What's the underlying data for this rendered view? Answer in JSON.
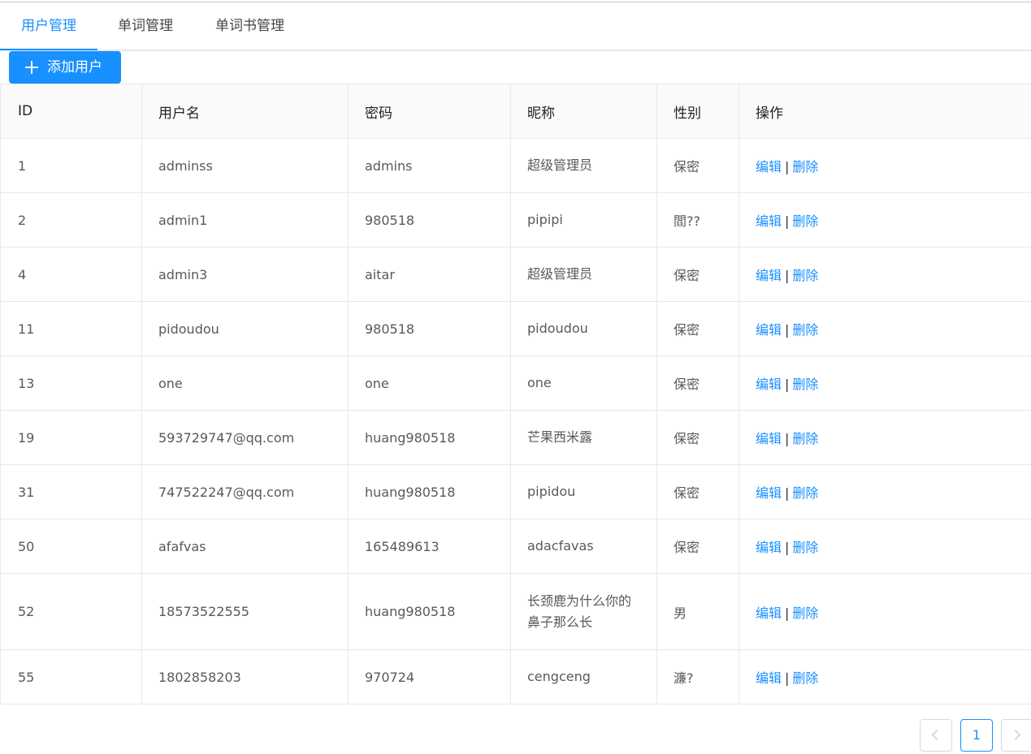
{
  "tabs": [
    {
      "label": "用户管理",
      "active": true
    },
    {
      "label": "单词管理",
      "active": false
    },
    {
      "label": "单词书管理",
      "active": false
    }
  ],
  "toolbar": {
    "add_label": "添加用户",
    "add_icon": "plus-icon"
  },
  "table": {
    "columns": [
      "ID",
      "用户名",
      "密码",
      "昵称",
      "性别",
      "操作"
    ],
    "actions": {
      "edit": "编辑",
      "separator": "|",
      "delete": "删除"
    },
    "rows": [
      {
        "id": "1",
        "username": "adminss",
        "password": "admins",
        "nickname": "超级管理员",
        "gender": "保密"
      },
      {
        "id": "2",
        "username": "admin1",
        "password": "980518",
        "nickname": "pipipi",
        "gender": "閻??"
      },
      {
        "id": "4",
        "username": "admin3",
        "password": "aitar",
        "nickname": "超级管理员",
        "gender": "保密"
      },
      {
        "id": "11",
        "username": "pidoudou",
        "password": "980518",
        "nickname": "pidoudou",
        "gender": "保密"
      },
      {
        "id": "13",
        "username": "one",
        "password": "one",
        "nickname": "one",
        "gender": "保密"
      },
      {
        "id": "19",
        "username": "593729747@qq.com",
        "password": "huang980518",
        "nickname": "芒果西米露",
        "gender": "保密"
      },
      {
        "id": "31",
        "username": "747522247@qq.com",
        "password": "huang980518",
        "nickname": "pipidou",
        "gender": "保密"
      },
      {
        "id": "50",
        "username": "afafvas",
        "password": "165489613",
        "nickname": "adacfavas",
        "gender": "保密"
      },
      {
        "id": "52",
        "username": "18573522555",
        "password": "huang980518",
        "nickname": "长颈鹿为什么你的鼻子那么长",
        "gender": "男"
      },
      {
        "id": "55",
        "username": "1802858203",
        "password": "970724",
        "nickname": "cengceng",
        "gender": "濂?"
      }
    ]
  },
  "pagination": {
    "current": "1",
    "prev_icon": "chevron-left-icon",
    "next_icon": "chevron-right-icon"
  },
  "colors": {
    "accent": "#1890ff"
  }
}
